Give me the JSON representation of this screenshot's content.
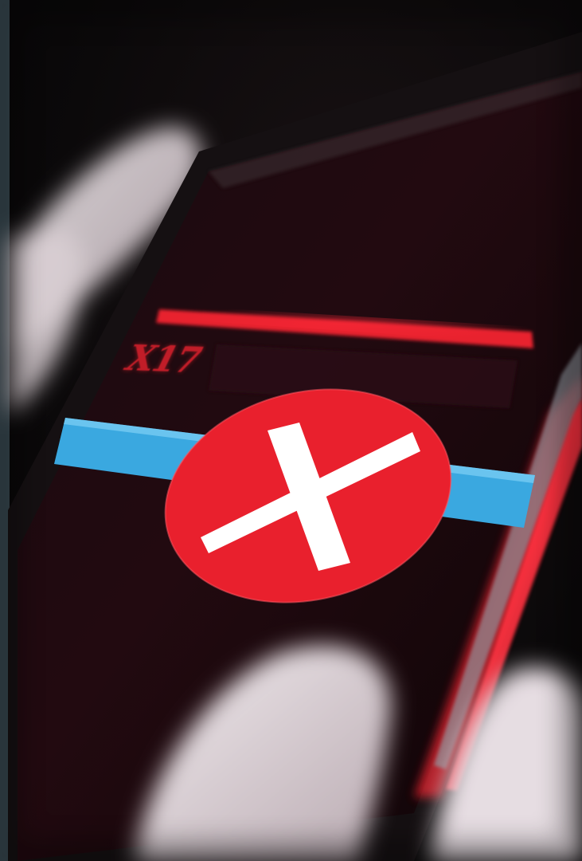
{
  "screen": {
    "label_text": "X17"
  },
  "icons": {
    "status": "close-icon"
  },
  "colors": {
    "background": "#0b090a",
    "frame_strip": "#37474f",
    "error_red": "#e8202e",
    "progress_blue": "#3aa8e0",
    "glove": "#e9e2e6"
  }
}
